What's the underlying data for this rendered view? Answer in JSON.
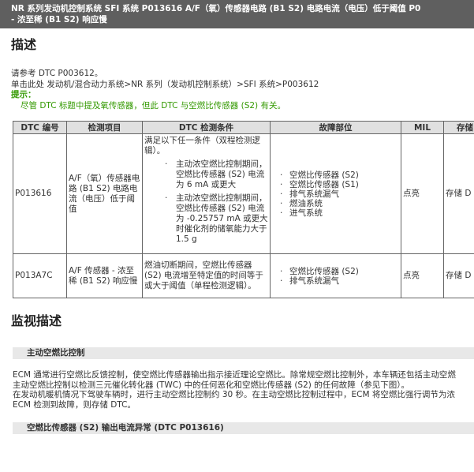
{
  "header": {
    "title_line1": "NR 系列发动机控制系统  SFI 系统  P013616  A/F（氧）传感器电路 (B1 S2) 电路电流（电压）低于阈值  P0",
    "title_line2": "- 浓至稀 (B1 S2) 响应慢"
  },
  "description": {
    "heading": "描述",
    "ref_line": "请参考 DTC P003612。",
    "nav_line": "单击此处 发动机/混合动力系统>NR 系列（发动机控制系统）>SFI 系统>P003612",
    "hint_label": "提示：",
    "hint_text": "尽管 DTC 标题中提及氧传感器，但此 DTC 与空燃比传感器 (S2) 有关。"
  },
  "table": {
    "headers": [
      "DTC 编号",
      "检测项目",
      "DTC 检测条件",
      "故障部位",
      "MIL",
      "存储"
    ],
    "rows": [
      {
        "code": "P013616",
        "item": "A/F（氧）传感器电路 (B1 S2) 电路电流（电压）低于阈值",
        "condition_intro": "满足以下任一条件（双程检测逻辑）。",
        "conditions": [
          "主动浓空燃比控制期间，空燃比传感器 (S2) 电流为 6 mA 或更大",
          "主动浓空燃比控制期间，空燃比传感器 (S2) 电流为 -0.25757 mA 或更大时催化剂的储氧能力大于 1.5 g"
        ],
        "parts": [
          "空燃比传感器 (S2)",
          "空燃比传感器 (S1)",
          "排气系统漏气",
          "燃油系统",
          "进气系统"
        ],
        "mil": "点亮",
        "memory": "存储 D"
      },
      {
        "code": "P013A7C",
        "item": "A/F 传感器 - 浓至稀 (B1 S2) 响应慢",
        "condition": "燃油切断期间，空燃比传感器 (S2) 电流增至特定值的时间等于或大于阈值（单程检测逻辑）。",
        "parts": [
          "空燃比传感器 (S2)",
          "排气系统漏气"
        ],
        "mil": "点亮",
        "memory": "存储 D"
      }
    ]
  },
  "monitor": {
    "heading": "监视描述",
    "sub1": "主动空燃比控制",
    "lines": [
      "ECM 通常进行空燃比反馈控制，使空燃比传感器输出指示接近理论空燃比。除常规空燃比控制外，本车辆还包括主动空燃",
      "主动空燃比控制以检测三元催化转化器 (TWC) 中的任何恶化和空燃比传感器 (S2) 的任何故障（参见下图）。",
      "在发动机暖机情况下驾驶车辆时，进行主动空燃比控制约 30 秒。在主动空燃比控制过程中，ECM 将空燃比强行调节为浓",
      "ECM 检测到故障，则存储 DTC。"
    ],
    "sub2": "空燃比传感器 (S2) 输出电流异常 (DTC P013616)"
  }
}
